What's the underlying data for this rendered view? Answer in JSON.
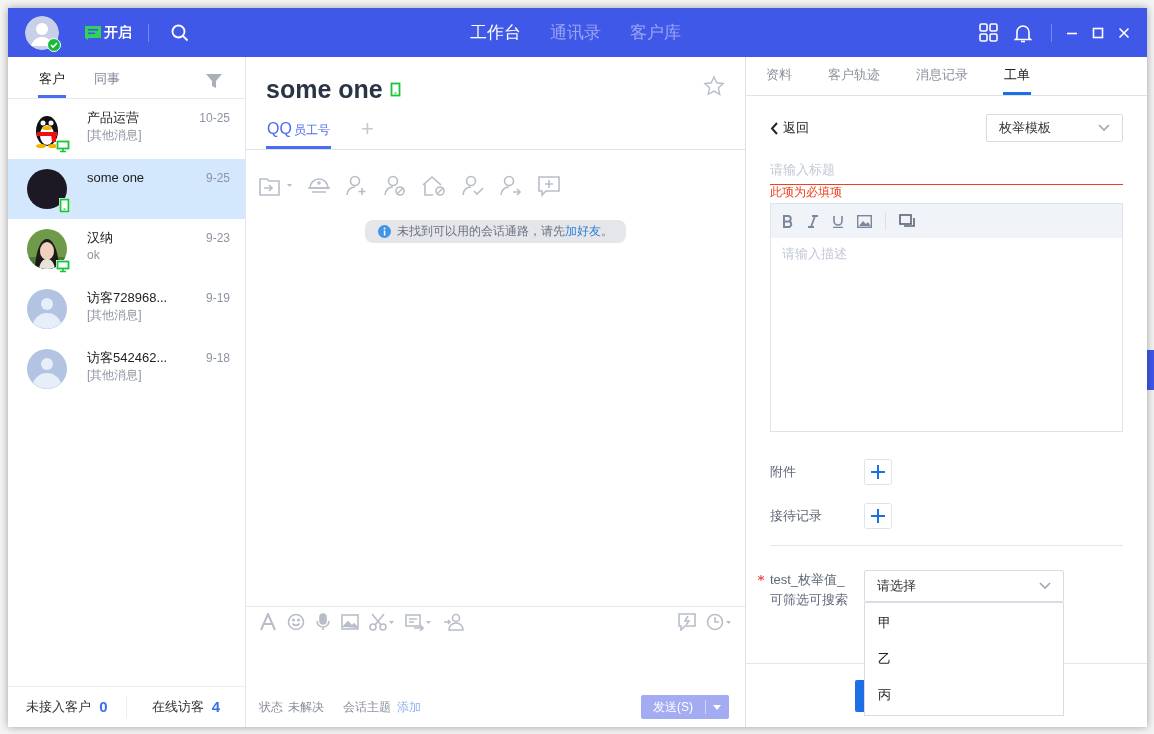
{
  "header": {
    "status_label": "开启",
    "nav": [
      {
        "label": "工作台",
        "selected": true
      },
      {
        "label": "通讯录",
        "selected": false
      },
      {
        "label": "客户库",
        "selected": false
      }
    ]
  },
  "sidebar": {
    "tabs": [
      {
        "label": "客户",
        "selected": true
      },
      {
        "label": "同事",
        "selected": false
      }
    ],
    "contacts": [
      {
        "name": "产品运营",
        "time": "10-25",
        "preview": "[其他消息]",
        "selected": false
      },
      {
        "name": "some one",
        "time": "9-25",
        "selected": true
      },
      {
        "name": "汉纳",
        "time": "9-23",
        "preview": "ok",
        "selected": false
      },
      {
        "name": "访客728968...",
        "time": "9-19",
        "preview": "[其他消息]",
        "selected": false
      },
      {
        "name": "访客542462...",
        "time": "9-18",
        "preview": "[其他消息]",
        "selected": false
      }
    ],
    "footer": [
      {
        "label": "未接入客户",
        "count": "0"
      },
      {
        "label": "在线访客",
        "count": "4"
      }
    ]
  },
  "chat": {
    "name": "some one",
    "channels": [
      {
        "label": "QQ",
        "sublabel": "员工号",
        "selected": true
      }
    ],
    "add_channel": "+",
    "notice": {
      "text": "未找到可以用的会话通路，请先",
      "link": "加好友",
      "suffix": "。"
    },
    "status_label": "状态",
    "status_value": "未解决",
    "topic_label": "会话主题",
    "topic_link": "添加",
    "send": "发送(S)"
  },
  "detail": {
    "tabs": [
      {
        "label": "资料",
        "selected": false
      },
      {
        "label": "客户轨迹",
        "selected": false
      },
      {
        "label": "消息记录",
        "selected": false
      },
      {
        "label": "工单",
        "selected": true
      }
    ],
    "back": "返回",
    "template": "枚举模板",
    "title_placeholder": "请输入标题",
    "title_error": "此项为必填项",
    "description_placeholder": "请输入描述",
    "attachments_label": "附件",
    "records_label": "接待记录",
    "field": {
      "label": "test_枚举值_可筛选可搜索",
      "required": true,
      "placeholder": "请选择",
      "expanded": true,
      "options": [
        "甲",
        "乙",
        "丙"
      ]
    }
  }
}
